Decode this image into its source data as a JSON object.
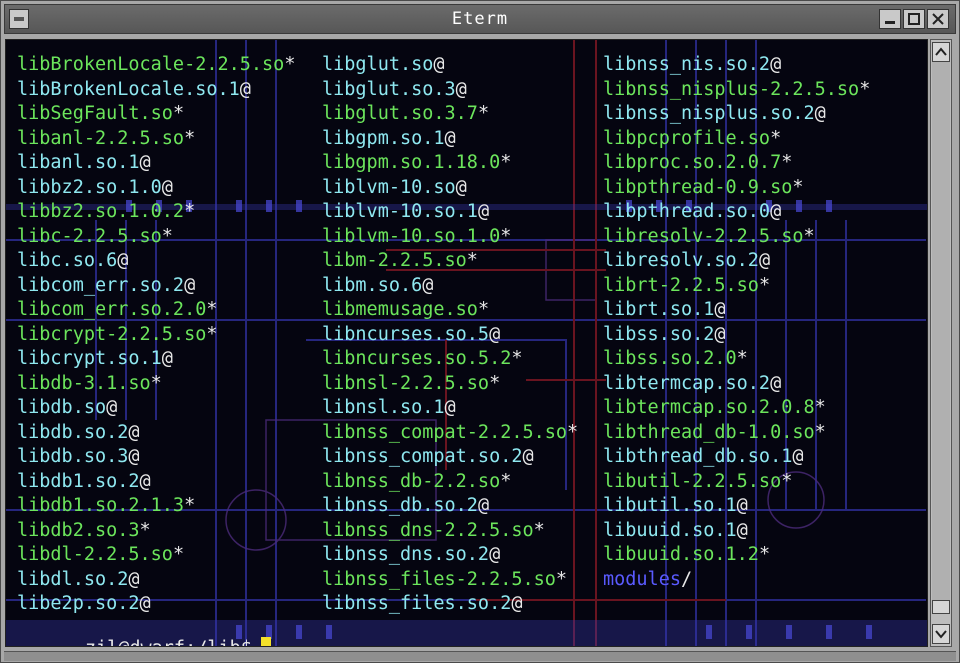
{
  "window": {
    "title": "Eterm",
    "buttons": [
      "minimize-icon",
      "maximize-icon",
      "close-icon"
    ]
  },
  "terminal": {
    "columns": [
      [
        {
          "text": "libBrokenLocale-2.2.5.so",
          "suffix": "*",
          "color": "green"
        },
        {
          "text": "libBrokenLocale.so.1",
          "suffix": "@",
          "color": "cyan"
        },
        {
          "text": "libSegFault.so",
          "suffix": "*",
          "color": "green"
        },
        {
          "text": "libanl-2.2.5.so",
          "suffix": "*",
          "color": "green"
        },
        {
          "text": "libanl.so.1",
          "suffix": "@",
          "color": "cyan"
        },
        {
          "text": "libbz2.so.1.0",
          "suffix": "@",
          "color": "cyan"
        },
        {
          "text": "libbz2.so.1.0.2",
          "suffix": "*",
          "color": "green"
        },
        {
          "text": "libc-2.2.5.so",
          "suffix": "*",
          "color": "green"
        },
        {
          "text": "libc.so.6",
          "suffix": "@",
          "color": "cyan"
        },
        {
          "text": "libcom_err.so.2",
          "suffix": "@",
          "color": "cyan"
        },
        {
          "text": "libcom_err.so.2.0",
          "suffix": "*",
          "color": "green"
        },
        {
          "text": "libcrypt-2.2.5.so",
          "suffix": "*",
          "color": "green"
        },
        {
          "text": "libcrypt.so.1",
          "suffix": "@",
          "color": "cyan"
        },
        {
          "text": "libdb-3.1.so",
          "suffix": "*",
          "color": "green"
        },
        {
          "text": "libdb.so",
          "suffix": "@",
          "color": "cyan"
        },
        {
          "text": "libdb.so.2",
          "suffix": "@",
          "color": "cyan"
        },
        {
          "text": "libdb.so.3",
          "suffix": "@",
          "color": "cyan"
        },
        {
          "text": "libdb1.so.2",
          "suffix": "@",
          "color": "cyan"
        },
        {
          "text": "libdb1.so.2.1.3",
          "suffix": "*",
          "color": "green"
        },
        {
          "text": "libdb2.so.3",
          "suffix": "*",
          "color": "green"
        },
        {
          "text": "libdl-2.2.5.so",
          "suffix": "*",
          "color": "green"
        },
        {
          "text": "libdl.so.2",
          "suffix": "@",
          "color": "cyan"
        },
        {
          "text": "libe2p.so.2",
          "suffix": "@",
          "color": "cyan"
        }
      ],
      [
        {
          "text": "libglut.so",
          "suffix": "@",
          "color": "cyan"
        },
        {
          "text": "libglut.so.3",
          "suffix": "@",
          "color": "cyan"
        },
        {
          "text": "libglut.so.3.7",
          "suffix": "*",
          "color": "green"
        },
        {
          "text": "libgpm.so.1",
          "suffix": "@",
          "color": "cyan"
        },
        {
          "text": "libgpm.so.1.18.0",
          "suffix": "*",
          "color": "green"
        },
        {
          "text": "liblvm-10.so",
          "suffix": "@",
          "color": "cyan"
        },
        {
          "text": "liblvm-10.so.1",
          "suffix": "@",
          "color": "cyan"
        },
        {
          "text": "liblvm-10.so.1.0",
          "suffix": "*",
          "color": "green"
        },
        {
          "text": "libm-2.2.5.so",
          "suffix": "*",
          "color": "green"
        },
        {
          "text": "libm.so.6",
          "suffix": "@",
          "color": "cyan"
        },
        {
          "text": "libmemusage.so",
          "suffix": "*",
          "color": "green"
        },
        {
          "text": "libncurses.so.5",
          "suffix": "@",
          "color": "cyan"
        },
        {
          "text": "libncurses.so.5.2",
          "suffix": "*",
          "color": "green"
        },
        {
          "text": "libnsl-2.2.5.so",
          "suffix": "*",
          "color": "green"
        },
        {
          "text": "libnsl.so.1",
          "suffix": "@",
          "color": "cyan"
        },
        {
          "text": "libnss_compat-2.2.5.so",
          "suffix": "*",
          "color": "green"
        },
        {
          "text": "libnss_compat.so.2",
          "suffix": "@",
          "color": "cyan"
        },
        {
          "text": "libnss_db-2.2.so",
          "suffix": "*",
          "color": "green"
        },
        {
          "text": "libnss_db.so.2",
          "suffix": "@",
          "color": "cyan"
        },
        {
          "text": "libnss_dns-2.2.5.so",
          "suffix": "*",
          "color": "green"
        },
        {
          "text": "libnss_dns.so.2",
          "suffix": "@",
          "color": "cyan"
        },
        {
          "text": "libnss_files-2.2.5.so",
          "suffix": "*",
          "color": "green"
        },
        {
          "text": "libnss_files.so.2",
          "suffix": "@",
          "color": "cyan"
        }
      ],
      [
        {
          "text": "libnss_nis.so.2",
          "suffix": "@",
          "color": "cyan"
        },
        {
          "text": "libnss_nisplus-2.2.5.so",
          "suffix": "*",
          "color": "green"
        },
        {
          "text": "libnss_nisplus.so.2",
          "suffix": "@",
          "color": "cyan"
        },
        {
          "text": "libpcprofile.so",
          "suffix": "*",
          "color": "green"
        },
        {
          "text": "libproc.so.2.0.7",
          "suffix": "*",
          "color": "green"
        },
        {
          "text": "libpthread-0.9.so",
          "suffix": "*",
          "color": "green"
        },
        {
          "text": "libpthread.so.0",
          "suffix": "@",
          "color": "cyan"
        },
        {
          "text": "libresolv-2.2.5.so",
          "suffix": "*",
          "color": "green"
        },
        {
          "text": "libresolv.so.2",
          "suffix": "@",
          "color": "cyan"
        },
        {
          "text": "librt-2.2.5.so",
          "suffix": "*",
          "color": "green"
        },
        {
          "text": "librt.so.1",
          "suffix": "@",
          "color": "cyan"
        },
        {
          "text": "libss.so.2",
          "suffix": "@",
          "color": "cyan"
        },
        {
          "text": "libss.so.2.0",
          "suffix": "*",
          "color": "green"
        },
        {
          "text": "libtermcap.so.2",
          "suffix": "@",
          "color": "cyan"
        },
        {
          "text": "libtermcap.so.2.0.8",
          "suffix": "*",
          "color": "green"
        },
        {
          "text": "libthread_db-1.0.so",
          "suffix": "*",
          "color": "green"
        },
        {
          "text": "libthread_db.so.1",
          "suffix": "@",
          "color": "cyan"
        },
        {
          "text": "libutil-2.2.5.so",
          "suffix": "*",
          "color": "green"
        },
        {
          "text": "libutil.so.1",
          "suffix": "@",
          "color": "cyan"
        },
        {
          "text": "libuuid.so.1",
          "suffix": "@",
          "color": "cyan"
        },
        {
          "text": "libuuid.so.1.2",
          "suffix": "*",
          "color": "green"
        },
        {
          "text": "modules",
          "suffix": "/",
          "color": "blue"
        }
      ]
    ],
    "prompt": "zil@dwarf:/lib$",
    "colors": {
      "cyan": "#8fe8f0",
      "green": "#6ce55c",
      "blue": "#5a5aff",
      "background": "#050510"
    }
  },
  "scrollbar": {
    "up": "up-arrow-icon",
    "down": "down-arrow-icon"
  }
}
